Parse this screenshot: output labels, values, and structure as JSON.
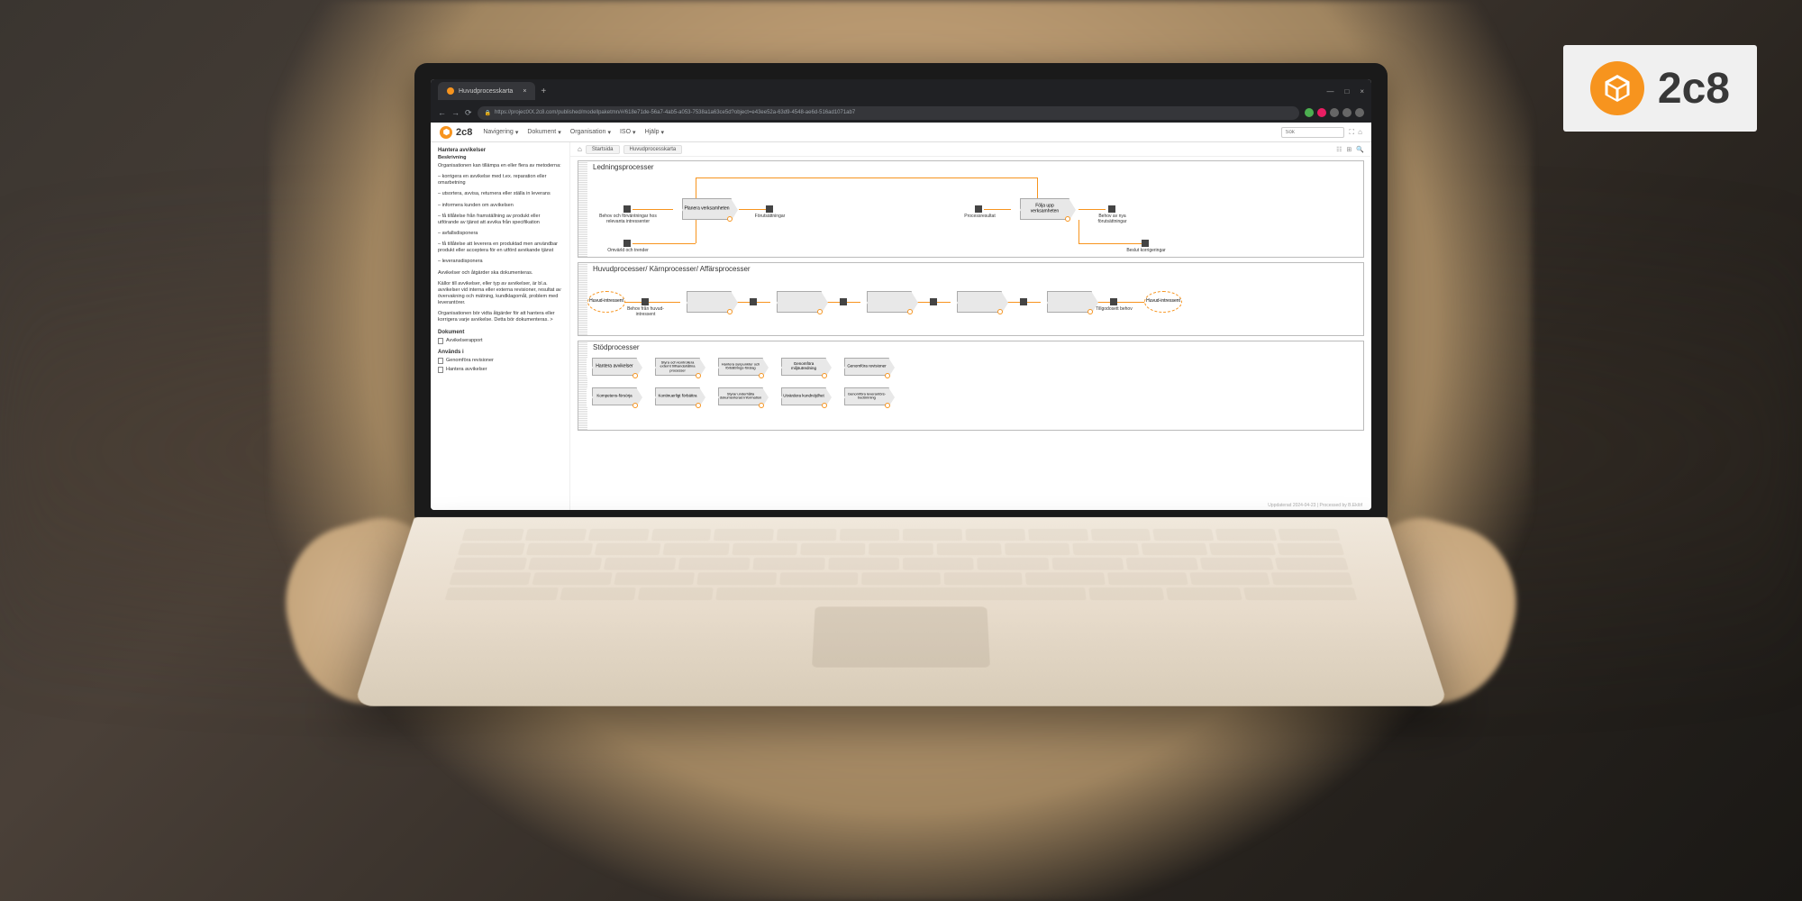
{
  "badge": {
    "text": "2c8"
  },
  "browser": {
    "tab_title": "Huvudprocesskarta",
    "url": "https://projectXX.2c8.com/published/modellpaketmn/#/618e71de-56a7-4ab5-a053-7538a1a63ce5d?object=e43ee52a-63d9-4548-ae6d-516ad1071ab7"
  },
  "app": {
    "logo": "2c8",
    "nav": [
      "Navigering",
      "Dokument",
      "Organisation",
      "ISO",
      "Hjälp"
    ],
    "search_placeholder": "Sök"
  },
  "sidebar": {
    "title": "Hantera avvikelser",
    "subtitle": "Beskrivning",
    "p1": "Organisationen kan tillämpa en eller flera av metoderna:",
    "bullets": [
      "– korrigera en avvikelse med t.ex. reparation eller omarbetning",
      "– utsortera, avvisa, returnera eller ställa in leverans",
      "– informera kunden om avvikelsen",
      "– få tillåtelse från framställning av produkt eller utförande av tjänst att avvika från specifikation",
      "– avfallsdisponera",
      "– få tillåtelse att leverera en produktad men användbar produkt eller acceptera för en utförd avvikande tjänst",
      "– leveransdisponera"
    ],
    "p2": "Avvikelser och åtgärder ska dokumenteras.",
    "p3": "Källor till avvikelser, eller typ av avvikelser, är bl.a. avvikelser vid interna eller externa revisioner, resultat av övervakning och mätning, kundklagomål, problem med leverantörer.",
    "p4": "Organisationen bör vidta åtgärder för att hantera eller korrigera varje avvikelse. Detta bör dokumenteras. >",
    "doc_header": "Dokument",
    "docs": [
      "Avvikelserapport"
    ],
    "used_header": "Används i",
    "used": [
      "Genomföra revisioner",
      "Hantera avvikelser"
    ]
  },
  "breadcrumbs": {
    "home": "⌂",
    "items": [
      "Startsida",
      "Huvudprocesskarta"
    ]
  },
  "sections": {
    "s1": {
      "title": "Ledningsprocesser",
      "left_inputs": [
        "Behov och förväntningar hos relevanta intressenter",
        "Omvärld och trender"
      ],
      "proc1": "Planera verksamheten",
      "out1": "Förutsättningar",
      "mid_in": "Processresultat",
      "proc2": "Följa upp verksamheten",
      "right_outputs": [
        "Behov av nya förutsättningar",
        "Beslut korrigeringar"
      ]
    },
    "s2": {
      "title": "Huvudprocesser/ Kärnprocesser/ Affärsprocesser",
      "start": "Huvud-intressent",
      "in_lbl": "Behov från huvud-intressent",
      "out_lbl": "Tillgodosett behov",
      "end": "Huvud-intressent"
    },
    "s3": {
      "title": "Stödprocesser",
      "row1": [
        "Hantera avvikelser",
        "Styra och kontrollera externt tillhandahållna processer",
        "Hantera synpunkter och förbättrings-förslag",
        "Genomföra miljöutredning",
        "Genomföra revisioner"
      ],
      "row2": [
        "Kompetens-försörja",
        "Kontinuerligt förbättra",
        "Styra/ underhålla dokumenterad information",
        "Utvärdera kundnöjdhet",
        "Genomföra leverantörs-bedömning"
      ]
    }
  },
  "footer": "Uppdaterad 2024-04-23 | Processed by B.Eklöf"
}
